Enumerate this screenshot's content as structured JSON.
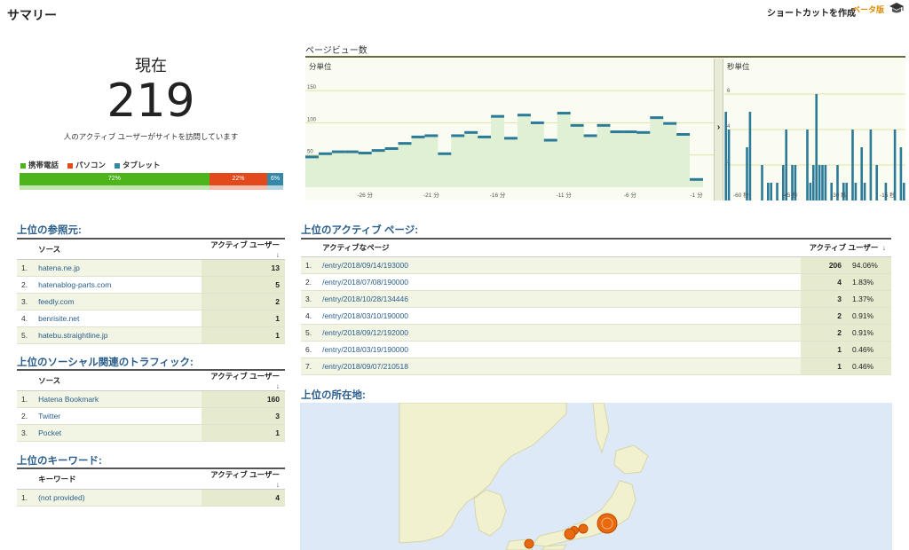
{
  "header": {
    "title": "サマリー",
    "shortcut_label": "ショートカットを作成",
    "beta_label": "ベータ版"
  },
  "realtime": {
    "now_label": "現在",
    "count": "219",
    "description": "人のアクティブ ユーザーがサイトを訪問しています",
    "devices": [
      {
        "label": "携帯電話",
        "pct_label": "72%",
        "share": 0.72,
        "color": "#4db41a"
      },
      {
        "label": "パソコン",
        "pct_label": "22%",
        "share": 0.22,
        "color": "#e24a1b"
      },
      {
        "label": "タブレット",
        "pct_label": "6%",
        "share": 0.06,
        "color": "#3588a8"
      }
    ]
  },
  "pageviews": {
    "title": "ページビュー数",
    "per_minute_label": "分単位",
    "per_second_label": "秒単位",
    "expand_arrow": "›",
    "chart_data": [
      {
        "type": "area",
        "title": "分単位",
        "y_ticks": [
          "150",
          "100",
          "50"
        ],
        "ylim": [
          0,
          175
        ],
        "x_tick_labels": [
          "-26 分",
          "-21 分",
          "-16 分",
          "-11 分",
          "-6 分",
          "-1 分"
        ],
        "x": [
          -30,
          -29,
          -28,
          -27,
          -26,
          -25,
          -24,
          -23,
          -22,
          -21,
          -20,
          -19,
          -18,
          -17,
          -16,
          -15,
          -14,
          -13,
          -12,
          -11,
          -10,
          -9,
          -8,
          -7,
          -6,
          -5,
          -4,
          -3,
          -2,
          -1
        ],
        "values": [
          47,
          52,
          55,
          55,
          53,
          57,
          60,
          68,
          78,
          80,
          52,
          80,
          85,
          78,
          110,
          76,
          112,
          100,
          73,
          115,
          96,
          80,
          96,
          86,
          86,
          85,
          108,
          99,
          82,
          12
        ]
      },
      {
        "type": "bar",
        "title": "秒単位",
        "y_ticks": [
          "6",
          "4",
          "2"
        ],
        "ylim": [
          0,
          7
        ],
        "x_tick_labels": [
          "-60 秒",
          "-45 秒",
          "-30 秒",
          "-15 秒"
        ],
        "values": [
          5,
          4,
          0,
          0,
          0,
          0,
          0,
          3,
          5,
          0,
          0,
          0,
          2,
          0,
          1,
          1,
          0,
          1,
          0,
          2,
          4,
          0,
          2,
          2,
          0,
          0,
          0,
          4,
          1,
          2,
          6,
          2,
          2,
          2,
          0,
          1,
          0,
          2,
          0,
          1,
          1,
          0,
          4,
          1,
          0,
          3,
          1,
          0,
          4,
          0,
          2,
          0,
          0,
          1,
          0,
          0,
          4,
          0,
          3,
          1
        ]
      }
    ]
  },
  "referrals": {
    "title": "上位の参照元:",
    "col_source": "ソース",
    "col_users": "アクティブ ユーザー",
    "rows": [
      {
        "idx": "1.",
        "name": "hatena.ne.jp",
        "users": "13"
      },
      {
        "idx": "2.",
        "name": "hatenablog-parts.com",
        "users": "5"
      },
      {
        "idx": "3.",
        "name": "feedly.com",
        "users": "2"
      },
      {
        "idx": "4.",
        "name": "benrisite.net",
        "users": "1"
      },
      {
        "idx": "5.",
        "name": "hatebu.straightline.jp",
        "users": "1"
      }
    ]
  },
  "social": {
    "title": "上位のソーシャル関連のトラフィック:",
    "col_source": "ソース",
    "col_users": "アクティブ ユーザー",
    "rows": [
      {
        "idx": "1.",
        "name": "Hatena Bookmark",
        "users": "160"
      },
      {
        "idx": "2.",
        "name": "Twitter",
        "users": "3"
      },
      {
        "idx": "3.",
        "name": "Pocket",
        "users": "1"
      }
    ]
  },
  "keywords": {
    "title": "上位のキーワード:",
    "col_keyword": "キーワード",
    "col_users": "アクティブ ユーザー",
    "rows": [
      {
        "idx": "1.",
        "name": "(not provided)",
        "users": "4"
      }
    ]
  },
  "active_pages": {
    "title": "上位のアクティブ ページ:",
    "col_page": "アクティブなページ",
    "col_users": "アクティブ ユーザー",
    "rows": [
      {
        "idx": "1.",
        "page": "/entry/2018/09/14/193000",
        "users": "206",
        "pct": "94.06%"
      },
      {
        "idx": "2.",
        "page": "/entry/2018/07/08/190000",
        "users": "4",
        "pct": "1.83%"
      },
      {
        "idx": "3.",
        "page": "/entry/2018/10/28/134446",
        "users": "3",
        "pct": "1.37%"
      },
      {
        "idx": "4.",
        "page": "/entry/2018/03/10/190000",
        "users": "2",
        "pct": "0.91%"
      },
      {
        "idx": "5.",
        "page": "/entry/2018/09/12/192000",
        "users": "2",
        "pct": "0.91%"
      },
      {
        "idx": "6.",
        "page": "/entry/2018/03/19/190000",
        "users": "1",
        "pct": "0.46%"
      },
      {
        "idx": "7.",
        "page": "/entry/2018/09/07/210518",
        "users": "1",
        "pct": "0.46%"
      }
    ]
  },
  "locations": {
    "title": "上位の所在地:"
  },
  "sort_arrow": "↓"
}
